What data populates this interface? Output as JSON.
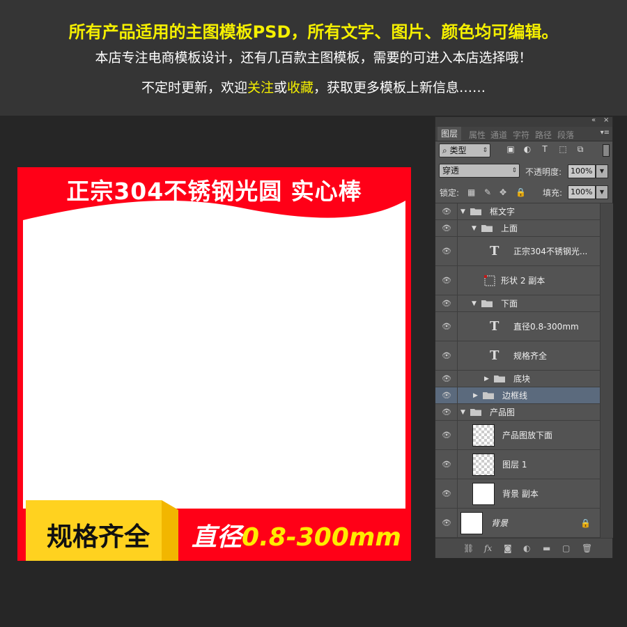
{
  "header": {
    "line1": "所有产品适用的主图模板PSD，所有文字、图片、颜色均可编辑。",
    "line2": "本店专注电商模板设计，还有几百款主图模板，需要的可进入本店选择哦！",
    "line3_a": "不定时更新，欢迎",
    "line3_follow": "关注",
    "line3_or": "或",
    "line3_fav": "收藏",
    "line3_b": "，获取更多模板上新信息……"
  },
  "canvas": {
    "title": "正宗304不锈钢光圆 实心棒",
    "spec": "规格齐全",
    "dia_prefix": "直径",
    "dia_value": "0.8-300mm"
  },
  "colors": {
    "red": "#ff0017",
    "yellow": "#ffd21f",
    "yellow_dark": "#f2b600",
    "highlight": "#f5f000"
  },
  "panel": {
    "tabs": [
      "图层",
      "属性",
      "通道",
      "字符",
      "路径",
      "段落"
    ],
    "filter_kind": "类型",
    "blend_mode": "穿透",
    "opacity_label": "不透明度:",
    "opacity_value": "100%",
    "lock_label": "锁定:",
    "fill_label": "填充:",
    "fill_value": "100%",
    "layers": [
      {
        "name": "框文字",
        "kind": "folder",
        "expanded": true
      },
      {
        "name": "上面",
        "kind": "folder",
        "expanded": true
      },
      {
        "name": "正宗304不锈钢光...",
        "kind": "text"
      },
      {
        "name": "形状 2 副本",
        "kind": "shape"
      },
      {
        "name": "下面",
        "kind": "folder",
        "expanded": true
      },
      {
        "name": "直径0.8-300mm",
        "kind": "text"
      },
      {
        "name": "规格齐全",
        "kind": "text"
      },
      {
        "name": "底块",
        "kind": "folder",
        "expanded": false
      },
      {
        "name": "边框线",
        "kind": "folder",
        "expanded": false,
        "selected": true
      },
      {
        "name": "产品图",
        "kind": "folder",
        "expanded": true
      },
      {
        "name": "产品图放下面",
        "kind": "pixel"
      },
      {
        "name": "图层 1",
        "kind": "pixel"
      },
      {
        "name": "背景 副本",
        "kind": "white"
      },
      {
        "name": "背景",
        "kind": "background",
        "locked": true
      }
    ]
  }
}
